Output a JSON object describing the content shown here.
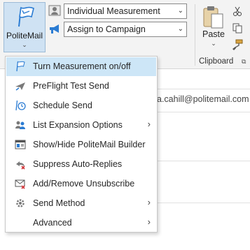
{
  "ribbon": {
    "politemail_label": "PoliteMail",
    "measurement_select": "Individual Measurement",
    "campaign_select": "Assign to Campaign",
    "paste_label": "Paste",
    "clipboard_label": "Clipboard"
  },
  "compose": {
    "to_email": "a.cahill@politemail.com"
  },
  "menu": {
    "items": [
      {
        "label": "Turn Measurement on/off",
        "icon": "measurement-flag-icon",
        "submenu": false
      },
      {
        "label": "PreFlight Test Send",
        "icon": "preflight-plane-icon",
        "submenu": false
      },
      {
        "label": "Schedule Send",
        "icon": "schedule-clock-icon",
        "submenu": false
      },
      {
        "label": "List Expansion Options",
        "icon": "list-expansion-people-icon",
        "submenu": true
      },
      {
        "label": "Show/Hide PoliteMail Builder",
        "icon": "builder-panel-icon",
        "submenu": false
      },
      {
        "label": "Suppress Auto-Replies",
        "icon": "suppress-replies-icon",
        "submenu": false
      },
      {
        "label": "Add/Remove Unsubscribe",
        "icon": "unsubscribe-envelope-icon",
        "submenu": false
      },
      {
        "label": "Send Method",
        "icon": "send-method-gear-icon",
        "submenu": true
      },
      {
        "label": "Advanced",
        "icon": "",
        "submenu": true
      }
    ]
  },
  "colors": {
    "accent": "#2b7cd3",
    "highlight": "#cde6f7",
    "ribbon_bg": "#f3f3f3"
  }
}
